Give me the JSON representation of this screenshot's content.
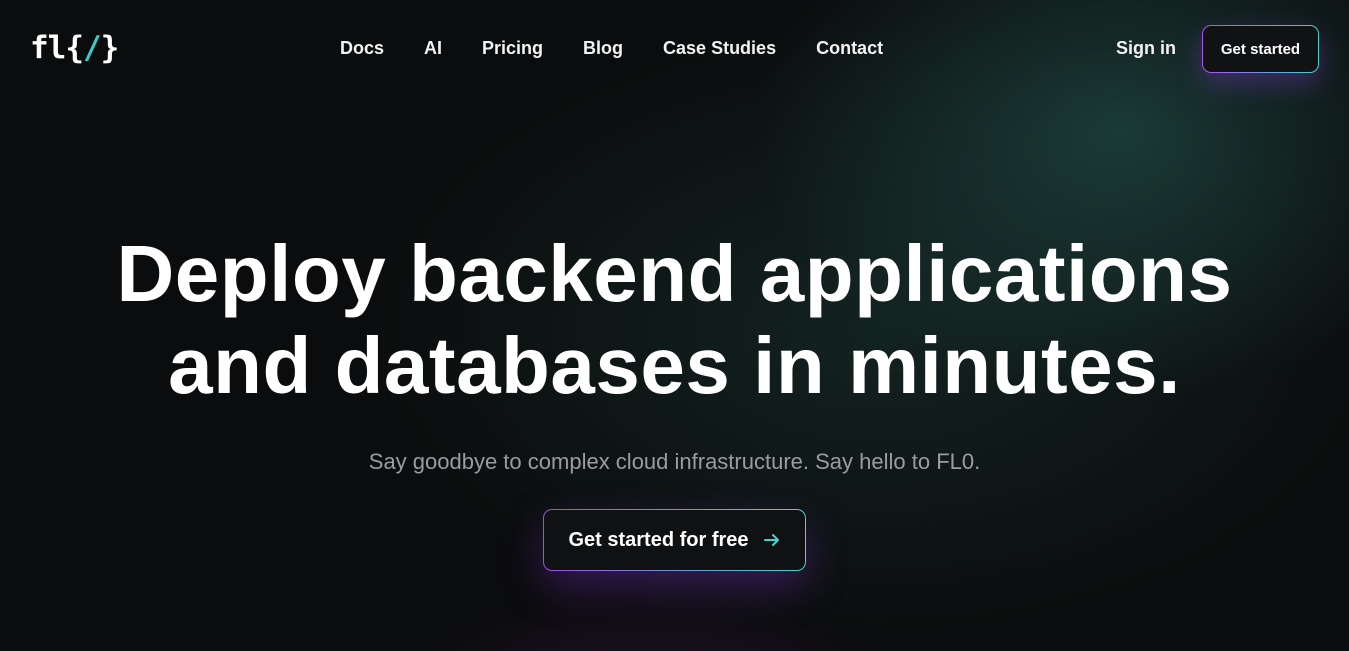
{
  "header": {
    "logo": {
      "prefix": "fl{",
      "slash": "/",
      "suffix": "}"
    },
    "nav": [
      {
        "label": "Docs"
      },
      {
        "label": "AI"
      },
      {
        "label": "Pricing"
      },
      {
        "label": "Blog"
      },
      {
        "label": "Case Studies"
      },
      {
        "label": "Contact"
      }
    ],
    "sign_in_label": "Sign in",
    "cta_label": "Get started"
  },
  "hero": {
    "headline_line1": "Deploy backend applications",
    "headline_line2": "and databases in minutes.",
    "subheadline": "Say goodbye to complex cloud infrastructure. Say hello to FL0.",
    "cta_label": "Get started for free",
    "cta_icon": "arrow-right-icon"
  },
  "colors": {
    "accent_teal": "#45d4cf",
    "accent_purple": "#a653e8",
    "background": "#0b0c0d",
    "subtext": "#9a9c9f"
  }
}
